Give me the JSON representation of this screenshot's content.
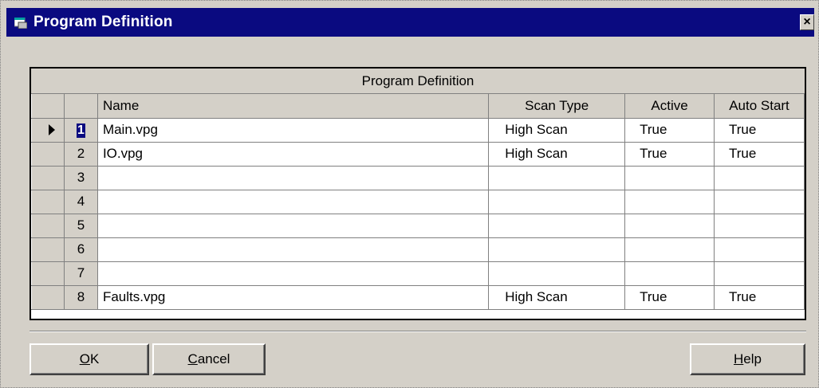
{
  "window": {
    "title": "Program Definition",
    "close_glyph": "×",
    "icon": "app-window-icon"
  },
  "grid": {
    "caption": "Program Definition",
    "columns": {
      "name": "Name",
      "scan_type": "Scan Type",
      "active": "Active",
      "auto_start": "Auto Start"
    },
    "current_row": 1,
    "rows": [
      {
        "num": "1",
        "name": "Main.vpg",
        "scan_type": "High Scan",
        "active": "True",
        "auto_start": "True"
      },
      {
        "num": "2",
        "name": "IO.vpg",
        "scan_type": "High Scan",
        "active": "True",
        "auto_start": "True"
      },
      {
        "num": "3",
        "name": "",
        "scan_type": "",
        "active": "",
        "auto_start": ""
      },
      {
        "num": "4",
        "name": "",
        "scan_type": "",
        "active": "",
        "auto_start": ""
      },
      {
        "num": "5",
        "name": "",
        "scan_type": "",
        "active": "",
        "auto_start": ""
      },
      {
        "num": "6",
        "name": "",
        "scan_type": "",
        "active": "",
        "auto_start": ""
      },
      {
        "num": "7",
        "name": "",
        "scan_type": "",
        "active": "",
        "auto_start": ""
      },
      {
        "num": "8",
        "name": "Faults.vpg",
        "scan_type": "High Scan",
        "active": "True",
        "auto_start": "True"
      }
    ]
  },
  "buttons": {
    "ok": {
      "accel": "O",
      "rest": "K"
    },
    "cancel": {
      "accel": "C",
      "rest": "ancel"
    },
    "help": {
      "accel": "H",
      "rest": "elp"
    }
  },
  "colors": {
    "titlebar": "#0a0a80",
    "face": "#d4d0c8",
    "grid_lines": "#808080"
  }
}
